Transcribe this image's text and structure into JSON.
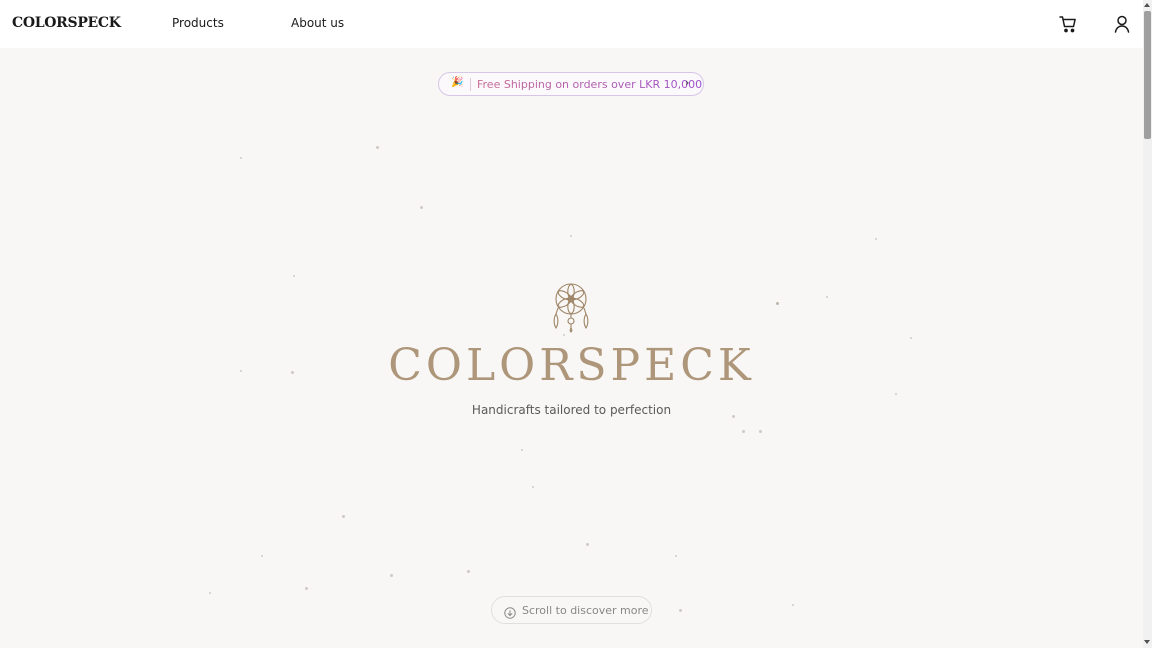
{
  "nav": {
    "brand": "COLORSPECK",
    "links": [
      "Products",
      "About us"
    ],
    "icons": [
      "cart-icon",
      "user-icon"
    ]
  },
  "promo": {
    "emoji": "🎉",
    "text": "Free Shipping on orders over LKR 10,000",
    "arrow": "›"
  },
  "hero": {
    "logo_icon": "dreamcatcher-icon",
    "title": "COLORSPECK",
    "tagline": "Handicrafts tailored to perfection"
  },
  "scroll_hint": {
    "icon": "arrow-down-circle-icon",
    "label": "Scroll to discover more"
  },
  "colors": {
    "accent": "#ad9679",
    "promo_gradient_start": "#c76a93",
    "promo_gradient_end": "#9b4fc9",
    "background": "#f8f7f5"
  }
}
